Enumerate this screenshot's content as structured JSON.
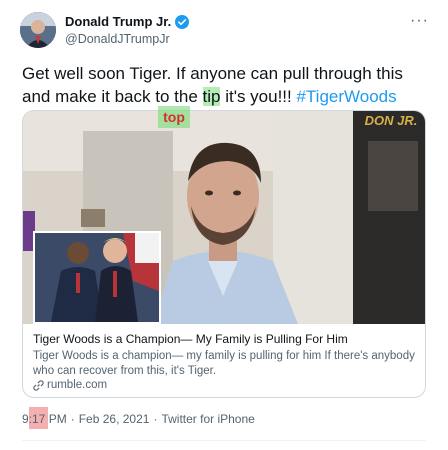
{
  "author": {
    "name": "Donald Trump Jr.",
    "handle": "@DonaldJTrumpJr",
    "verified_icon": "verified-badge-icon",
    "avatar_icon": "profile-avatar"
  },
  "more_label": "···",
  "tweet": {
    "text_before": "Get well soon Tiger. If anyone can pull through this and make it back to the ",
    "highlight_word": "tip",
    "text_after": " it's you!!! ",
    "hashtag": "#TigerWoods",
    "annotation": "top"
  },
  "card": {
    "title": "Tiger Woods is a Champion— My Family is Pulling For Him",
    "description": "Tiger Woods is a champion— my family is pulling for him If there's anybody who can recover from this, it's Tiger.",
    "domain": "rumble.com",
    "link_icon": "link-icon",
    "video_watermark": "DON JR."
  },
  "meta": {
    "time": "9:17 PM",
    "separator": "·",
    "date": "Feb 26, 2021",
    "client": "Twitter for iPhone"
  },
  "colors": {
    "link": "#1d9bf0",
    "text": "#0f1419",
    "secondary": "#536471",
    "highlight_green": "#78dc78",
    "highlight_red": "#e65050"
  }
}
